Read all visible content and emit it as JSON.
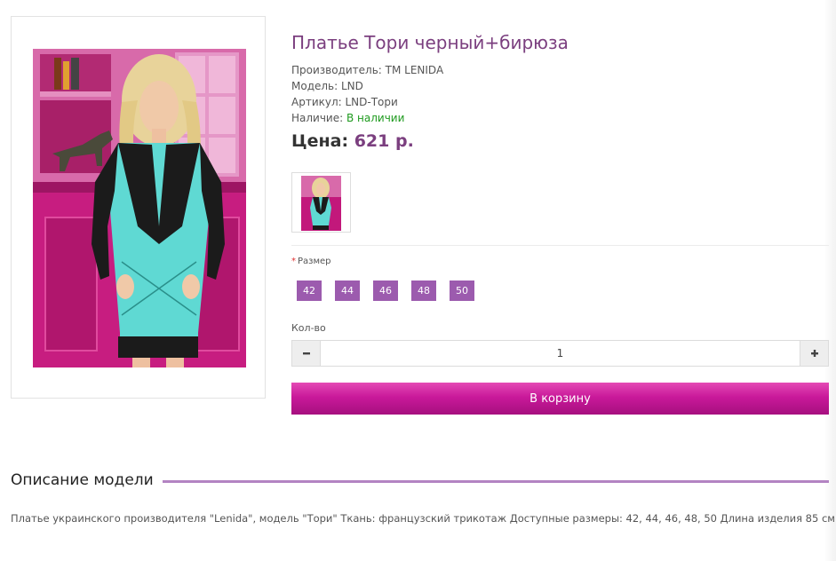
{
  "product": {
    "title": "Платье Тори черный+бирюза",
    "manufacturer": "Производитель: TM LENIDA",
    "model": "Модель: LND",
    "sku": "Артикул: LND-Тори",
    "availability_label": "Наличие:",
    "availability_value": "В наличии",
    "price_label": "Цена:",
    "price_value": "621 р."
  },
  "options": {
    "size_label": "Размер",
    "required_mark": "*",
    "sizes": [
      "42",
      "44",
      "46",
      "48",
      "50"
    ]
  },
  "quantity": {
    "label": "Кол-во",
    "value": "1",
    "minus_icon": "minus-icon",
    "plus_icon": "plus-icon"
  },
  "cart": {
    "button_label": "В корзину"
  },
  "description": {
    "title": "Описание модели",
    "text": "Платье украинского производителя \"Lenida\", модель \"Тори\" Ткань: французский трикотаж Доступные размеры: 42, 44, 46, 48, 50 Длина изделия 85 см"
  },
  "colors": {
    "accent": "#9c5bae",
    "title": "#7b3f7f",
    "cart_button": "#c9199a",
    "instock": "#1e9a1e",
    "dress": "#5fd9d3",
    "background_wall": "#c2187b"
  }
}
